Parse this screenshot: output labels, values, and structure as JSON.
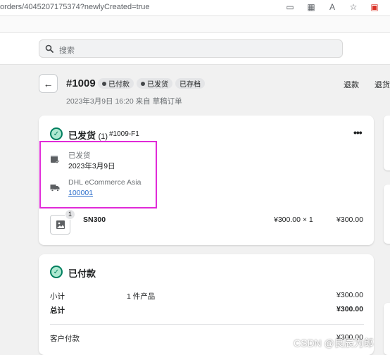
{
  "browser": {
    "url": "orders/4045207175374?newlyCreated=true",
    "icons": [
      "reader-mode-icon",
      "qr-code-icon",
      "read-aloud-icon",
      "favorites-icon",
      "extension-icon"
    ]
  },
  "search": {
    "placeholder": "搜索"
  },
  "header": {
    "title": "#1009",
    "badges": [
      "已付款",
      "已发货",
      "已存档"
    ],
    "subtitle": "2023年3月9日 16:20 来自 草稿订单",
    "actions": [
      "退款",
      "退货"
    ]
  },
  "fulfillment": {
    "title": "已发货",
    "count": "(1)",
    "fulfillment_id": "#1009-F1",
    "status_label": "已发货",
    "date": "2023年3月9日",
    "carrier": "DHL eCommerce Asia",
    "tracking_number": "100001",
    "item": {
      "quantity_badge": "1",
      "name": "SN300",
      "price_qty": "¥300.00 × 1",
      "total": "¥300.00"
    }
  },
  "payment": {
    "title": "已付款",
    "subtotal_label": "小计",
    "subtotal_items": "1 件产品",
    "subtotal_value": "¥300.00",
    "total_label": "总计",
    "total_value": "¥300.00",
    "paid_label": "客户付款",
    "paid_value": "¥300.00"
  },
  "watermark": "CSDN @良辰为郎",
  "colors": {
    "success": "#007f5f",
    "highlight": "#e02ad8",
    "link": "#2c6ecb"
  }
}
